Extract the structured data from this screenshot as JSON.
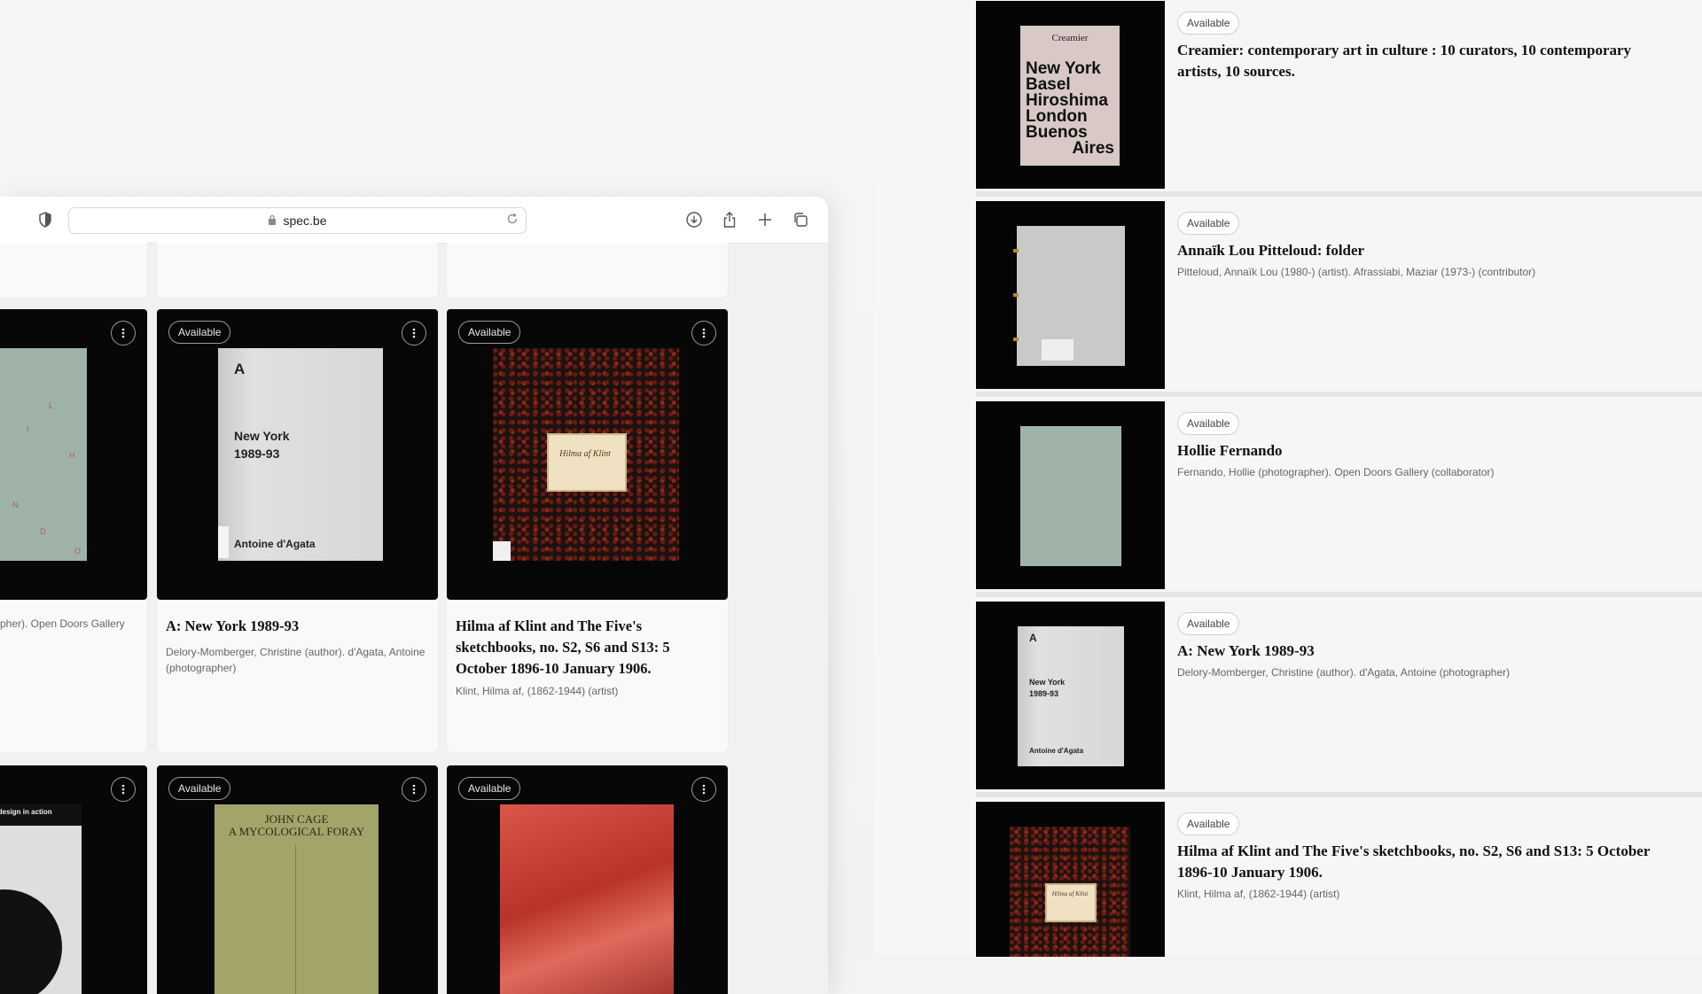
{
  "browser": {
    "url": "spec.be"
  },
  "grid": {
    "available_label": "Available",
    "cards": [
      {
        "meta": "pher). Open Doors Gallery"
      },
      {
        "title": "A: New York 1989-93",
        "meta": "Delory-Momberger, Christine (author). d'Agata, Antoine (photographer)",
        "cover_line1": "A",
        "cover_line2": "New York",
        "cover_line3": "1989-93",
        "cover_author": "Antoine d'Agata"
      },
      {
        "title": "Hilma af Klint and The Five's sketchbooks, no. S2, S6 and S13: 5 October 1896-10 January 1906.",
        "meta": "Klint, Hilma af, (1862-1944) (artist)",
        "cover_label": "Hilma af Klint"
      }
    ],
    "bottom_cards": [
      {
        "cover_text": "ual design in action"
      },
      {
        "cover_text": "JOHN CAGE\nA MYCOLOGICAL FORAY"
      },
      {
        "cover_text": ""
      }
    ]
  },
  "list": {
    "available_label": "Available",
    "items": [
      {
        "title": "Creamier: contemporary art in culture : 10 curators, 10 contemporary artists, 10 sources.",
        "meta": "",
        "cover_head": "Creamier",
        "cover_cities": [
          "New York",
          "Basel",
          "Hiroshima",
          "London",
          "Buenos"
        ],
        "cover_last": "Aires"
      },
      {
        "title": "Annaïk Lou Pitteloud: folder",
        "meta": "Pitteloud, Annaïk Lou (1980-) (artist). Afrassiabi, Maziar (1973-) (contributor)"
      },
      {
        "title": "Hollie Fernando",
        "meta": "Fernando, Hollie (photographer). Open Doors Gallery (collaborator)"
      },
      {
        "title": "A: New York 1989-93",
        "meta": "Delory-Momberger, Christine (author). d'Agata, Antoine (photographer)",
        "cover_line1": "A",
        "cover_line2": "New York",
        "cover_line3": "1989-93",
        "cover_author": "Antoine d'Agata"
      },
      {
        "title": "Hilma af Klint and The Five's sketchbooks, no. S2, S6 and S13: 5 October 1896-10 January 1906.",
        "meta": "Klint, Hilma af, (1862-1944) (artist)",
        "cover_label": "Hilma af Klint"
      }
    ]
  }
}
